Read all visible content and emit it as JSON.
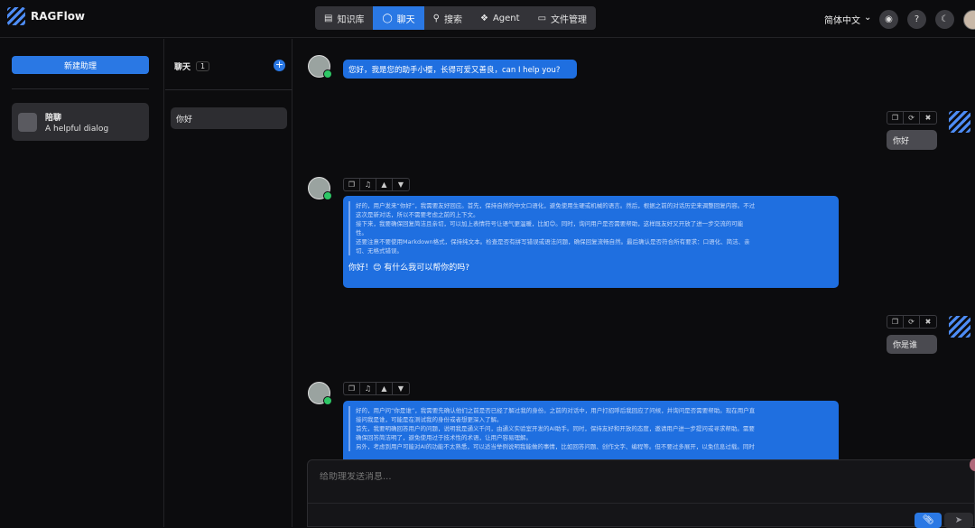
{
  "app": {
    "name": "RAGFlow"
  },
  "nav": {
    "tabs": [
      {
        "label": "知识库",
        "icon": "database-icon"
      },
      {
        "label": "聊天",
        "icon": "chat-icon",
        "active": true
      },
      {
        "label": "搜索",
        "icon": "search-icon"
      },
      {
        "label": "Agent",
        "icon": "agent-icon"
      },
      {
        "label": "文件管理",
        "icon": "folder-icon"
      }
    ],
    "language": "简体中文"
  },
  "sidebar": {
    "new_button": "新建助理",
    "assistant": {
      "name": "陪聊",
      "description": "A helpful dialog"
    }
  },
  "chatlist": {
    "title": "聊天",
    "count": "1",
    "items": [
      "你好"
    ]
  },
  "messages": {
    "greeting": "您好，我是您的助手小樱，长得可爱又善良，can I help you?",
    "user1": "你好",
    "reply1_think": [
      "好的，用户发来“你好”，我需要友好回应。首先，保持自然的中文口语化，避免使用生硬或机械的语言。然后，根据之前的对话历史来调整回复内容。不过",
      "这次是新对话，所以不需要考虑之前的上下文。",
      "接下来，我要确保回复简洁且亲切，可以加上表情符号让语气更温暖，比如😊。同时，询问用户是否需要帮助，这样既友好又开放了进一步交流的可能",
      "性。",
      "还要注意不要使用Markdown格式，保持纯文本。检查是否有拼写错误或语法问题，确保回复流畅自然。最后确认是否符合所有要求：口语化、简洁、亲",
      "切、无格式错误。"
    ],
    "reply1_answer": "你好！😊 有什么我可以帮你的吗?",
    "user2": "你是谁",
    "reply2_think": [
      "好的，用户问“你是谁”，我需要先确认他们之前是否已经了解过我的身份。之前的对话中，用户打招呼后我回应了问候，并询问是否需要帮助。现在用户直",
      "接问我是谁，可能是在测试我的身份或者想更深入了解。",
      "首先，我要明确回答用户的问题，说明我是通义千问，由通义实验室开发的AI助手。同时，保持友好和开放的态度，邀请用户进一步提问或寻求帮助。需要",
      "确保回答简洁明了，避免使用过于技术性的术语，让用户容易理解。",
      "另外，考虑到用户可能对AI的功能不太熟悉，可以适当举例说明我能做的事情，比如回答问题、创作文字、编程等。但不要过多展开，以免信息过载。同时"
    ]
  },
  "composer": {
    "placeholder": "给助理发送消息..."
  },
  "colors": {
    "accent": "#2a78e4",
    "background": "#0c0c0e",
    "user_bubble": "#4a4a50"
  }
}
